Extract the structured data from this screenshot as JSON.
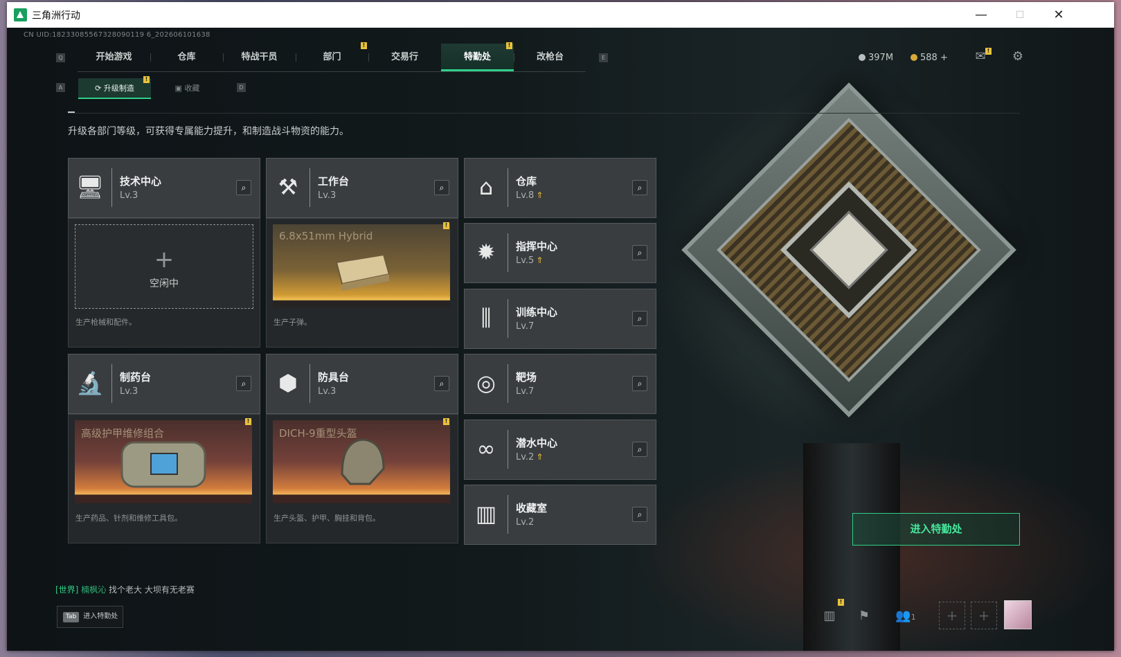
{
  "window": {
    "title": "三角洲行动",
    "minimize": "—",
    "maximize": "☐",
    "close": "✕"
  },
  "uid": "CN UID:18233085567328090119 6_202606101638",
  "nav": {
    "key_left": "Q",
    "key_right": "E",
    "tabs": [
      {
        "label": "开始游戏"
      },
      {
        "label": "仓库"
      },
      {
        "label": "特战干员"
      },
      {
        "label": "部门",
        "badge": "!"
      },
      {
        "label": "交易行"
      },
      {
        "label": "特勤处",
        "badge": "!",
        "active": true
      },
      {
        "label": "改枪台"
      }
    ]
  },
  "currency": {
    "silver": "397M",
    "gold": "588",
    "add": "+"
  },
  "subtabs": {
    "key_left": "A",
    "key_right": "D",
    "items": [
      {
        "label": "升级制造",
        "badge": "!",
        "active": true
      },
      {
        "label": "收藏"
      }
    ]
  },
  "description": "升级各部门等级，可获得专属能力提升，和制造战斗物资的能力。",
  "departments": [
    {
      "name": "技术中心",
      "level": "Lv.3",
      "icon": "monitor-icon",
      "desc": "生产枪械和配件。",
      "slot": "idle",
      "idle_label": "空闲中"
    },
    {
      "name": "工作台",
      "level": "Lv.3",
      "icon": "tools-icon",
      "desc": "生产子弹。",
      "slot": "product",
      "product": "6.8x51mm Hybrid",
      "theme": "gold",
      "badge": "!"
    },
    {
      "name": "仓库",
      "level": "Lv.8",
      "icon": "warehouse-icon",
      "upgrade": true
    },
    {
      "name": "指挥中心",
      "level": "Lv.5",
      "icon": "command-icon",
      "upgrade": true
    },
    {
      "name": "训练中心",
      "level": "Lv.7",
      "icon": "dumbbell-icon"
    },
    {
      "name": "制药台",
      "level": "Lv.3",
      "icon": "microscope-icon",
      "desc": "生产药品、针剂和维修工具包。",
      "slot": "product",
      "product": "高级护甲维修组合",
      "theme": "red",
      "badge": "!"
    },
    {
      "name": "防具台",
      "level": "Lv.3",
      "icon": "cubes-icon",
      "desc": "生产头盔、护甲、胸挂和背包。",
      "slot": "product",
      "product": "DICH-9重型头盔",
      "theme": "red",
      "badge": "!"
    },
    {
      "name": "靶场",
      "level": "Lv.7",
      "icon": "target-icon"
    },
    {
      "name": "潜水中心",
      "level": "Lv.2",
      "icon": "goggles-icon",
      "upgrade": true
    },
    {
      "name": "收藏室",
      "level": "Lv.2",
      "icon": "vault-icon"
    }
  ],
  "enter_button": "进入特勤处",
  "chat": {
    "channel": "[世界]",
    "user": "楠枫沁",
    "message": "找个老大 大坝有无老赛"
  },
  "tab_hint": {
    "key": "Tab",
    "label": "进入特勤处"
  },
  "bottom": {
    "friends": "1",
    "mail_badge": "!",
    "stats_badge": "!"
  },
  "colors": {
    "accent": "#2fd089",
    "badge": "#e8c23a",
    "card": "#3a3d40"
  }
}
